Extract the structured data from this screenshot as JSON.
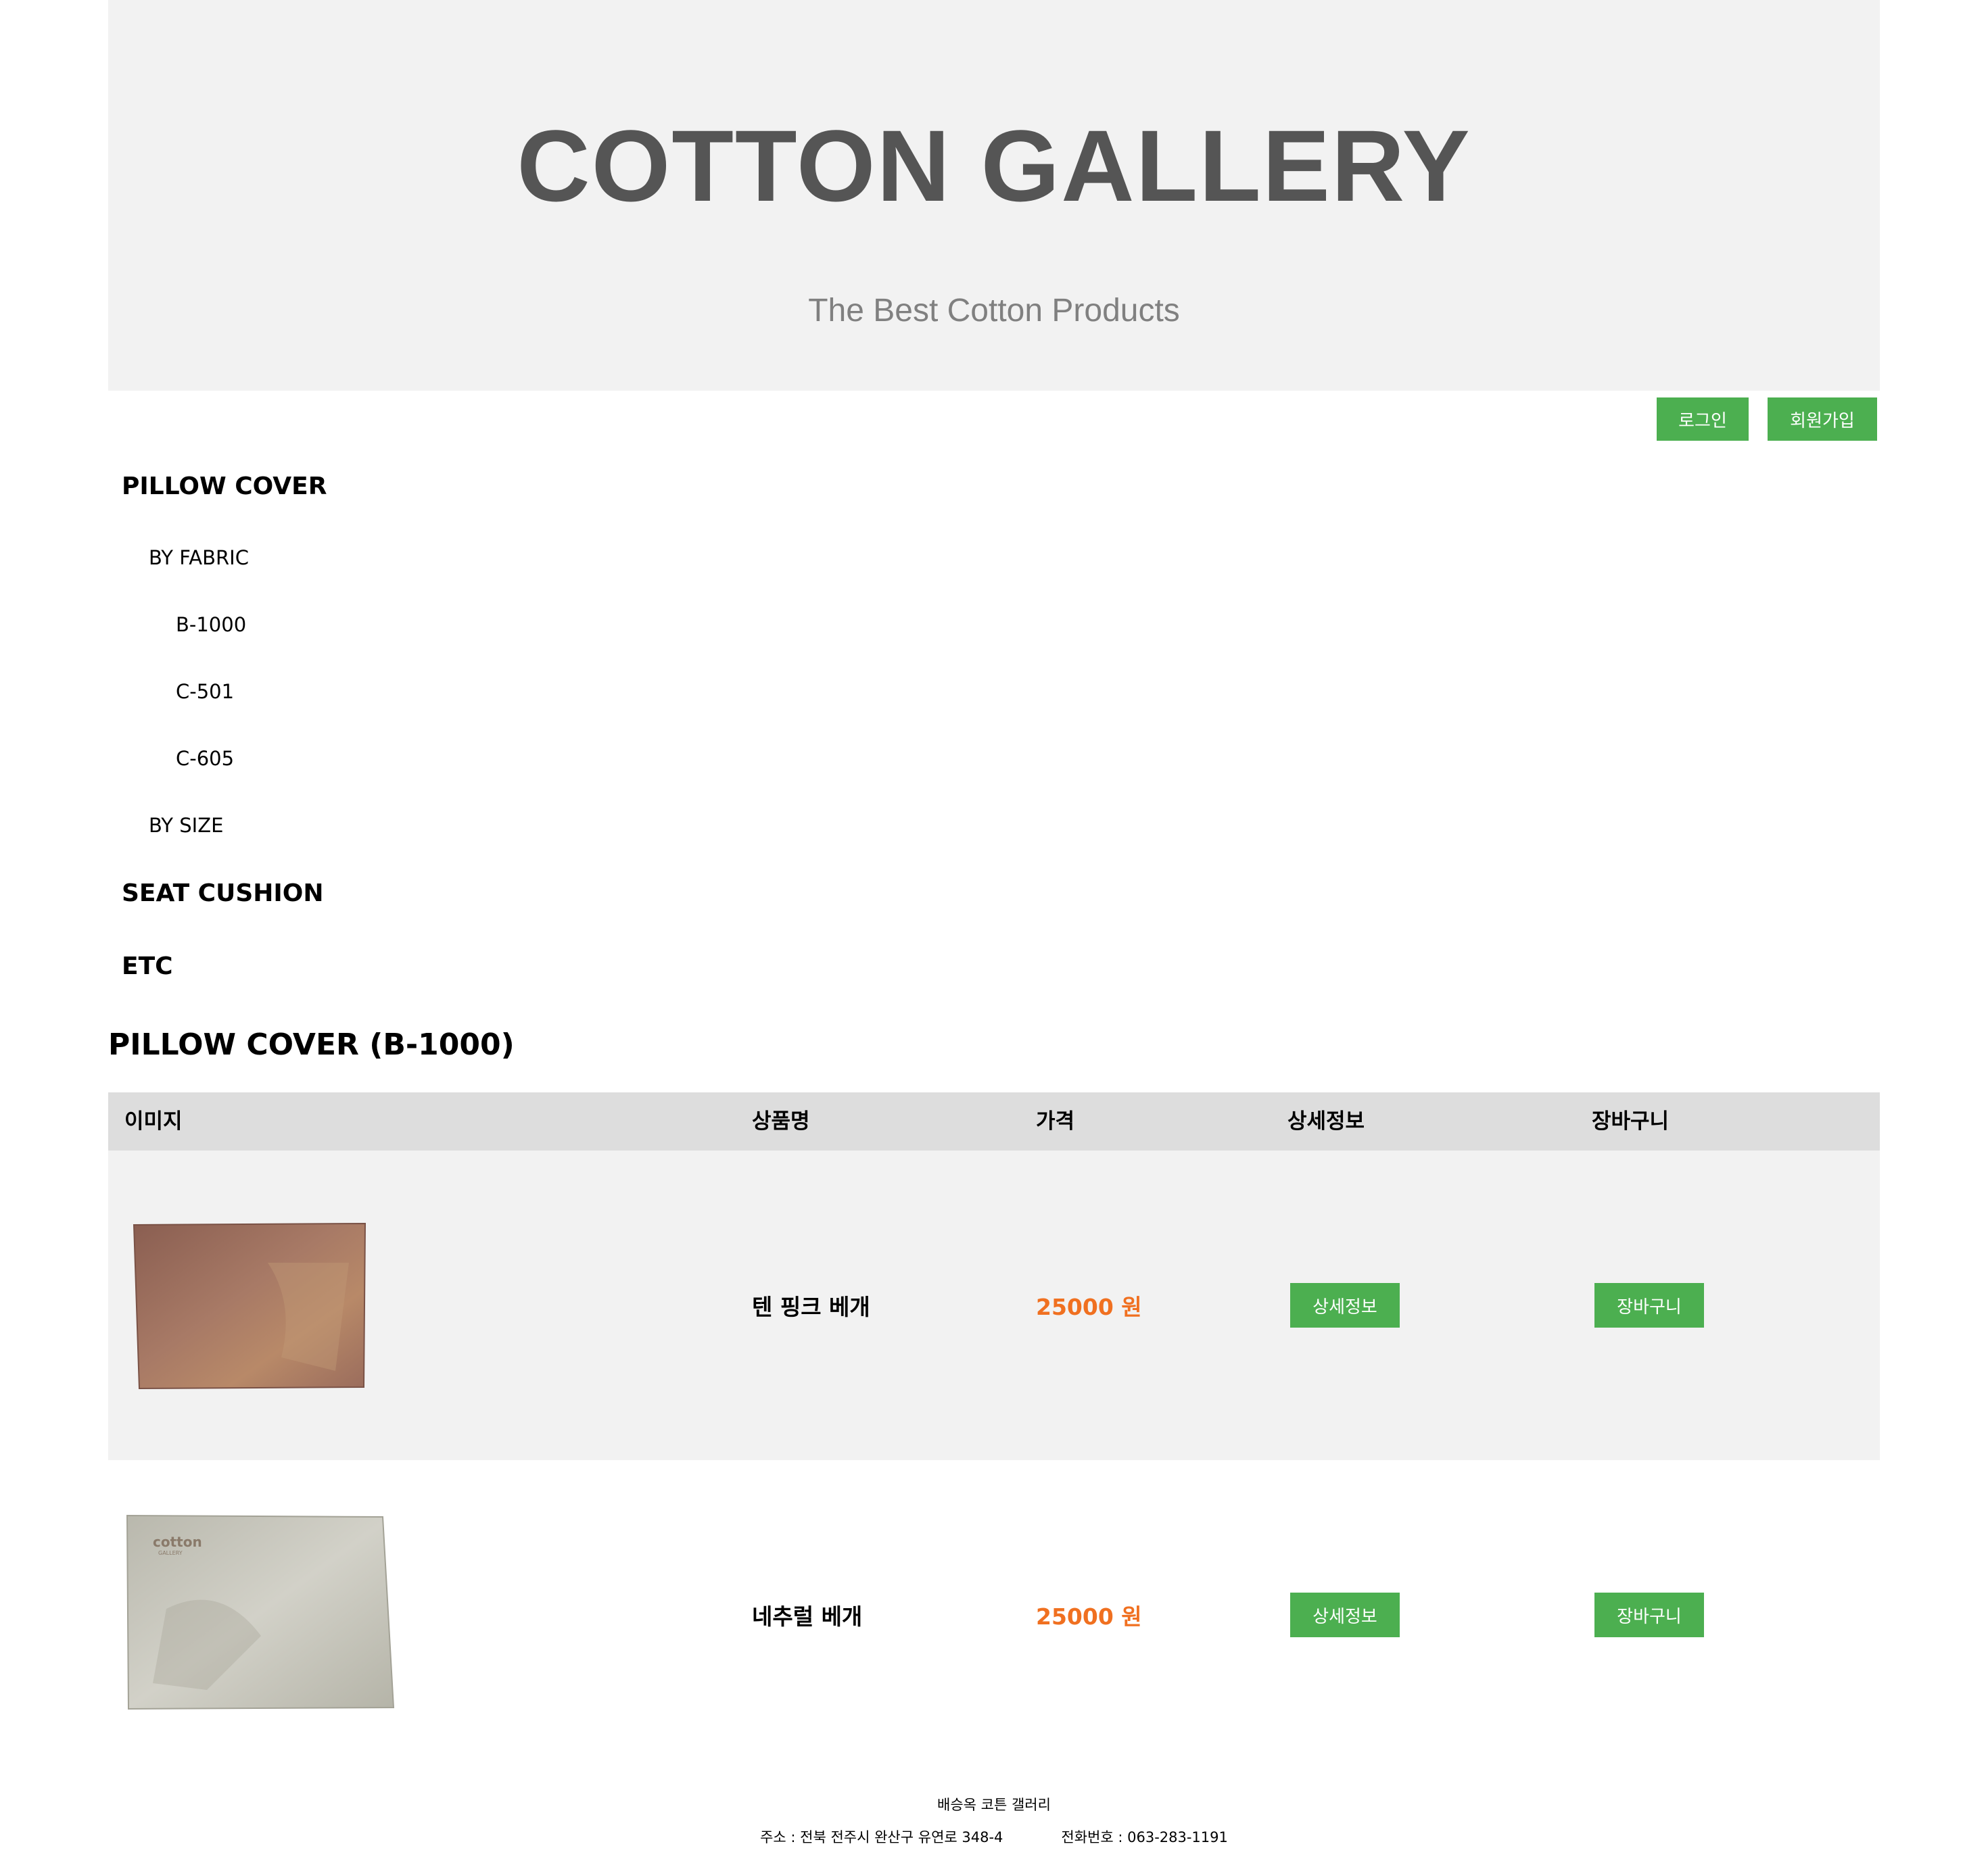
{
  "header": {
    "title": "COTTON GALLERY",
    "subtitle": "The Best Cotton Products"
  },
  "auth": {
    "login_label": "로그인",
    "signup_label": "회원가입"
  },
  "menu": {
    "pillow_cover": "PILLOW COVER",
    "by_fabric": "BY FABRIC",
    "fabrics": [
      "B-1000",
      "C-501",
      "C-605"
    ],
    "by_size": "BY SIZE",
    "seat_cushion": "SEAT CUSHION",
    "etc": "ETC"
  },
  "section": {
    "title": "PILLOW COVER (B-1000)"
  },
  "table": {
    "columns": [
      "이미지",
      "상품명",
      "가격",
      "상세정보",
      "장바구니"
    ],
    "rows": [
      {
        "name": "텐 핑크 베개",
        "price": "25000 원",
        "detail_label": "상세정보",
        "cart_label": "장바구니",
        "image": "pink-pillow-cover",
        "image_color": "#9a6c5c"
      },
      {
        "name": "네추럴 베개",
        "price": "25000 원",
        "detail_label": "상세정보",
        "cart_label": "장바구니",
        "image": "natural-pillow-cover",
        "image_color": "#c8c7bd"
      }
    ]
  },
  "footer": {
    "company": "배승옥 코튼 갤러리",
    "address": "주소 : 전북 전주시 완산구 유연로 348-4",
    "phone": "전화번호 : 063-283-1191"
  },
  "colors": {
    "header_bg": "#f2f2f2",
    "title": "#555555",
    "subtitle": "#808080",
    "button": "#4caf50",
    "price": "#f07020",
    "table_head_bg": "#dddddd",
    "row_alt_bg": "#f2f2f2"
  }
}
